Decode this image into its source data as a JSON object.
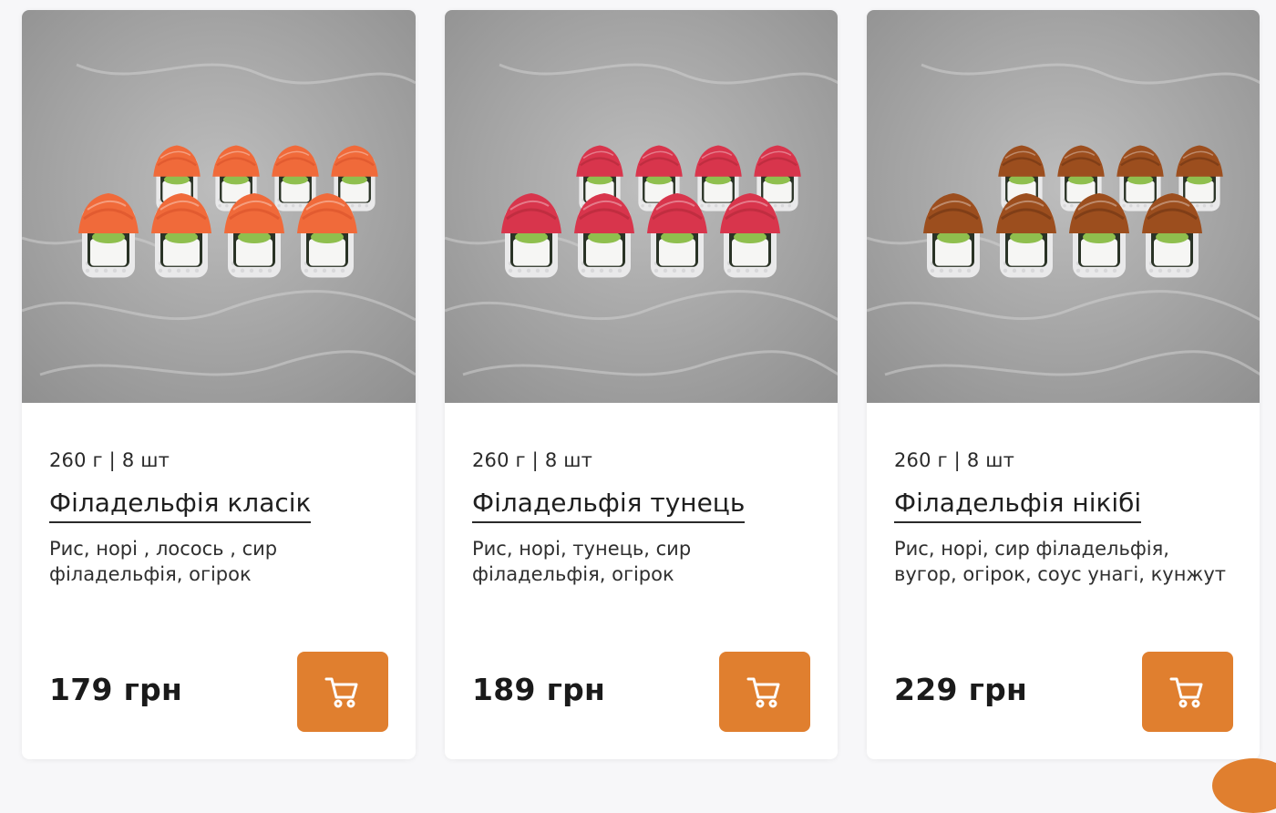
{
  "theme": {
    "accent": "#E07F2F",
    "background": "#f7f7f9"
  },
  "products": [
    {
      "weight": "260 г | 8 шт",
      "title": "Філадельфія класік",
      "description": "Рис, норі , лосось , сир філадельфія, огірок",
      "price": "179 грн",
      "topping_color": "#F06A3A",
      "topping_shade": "#d8522a",
      "image_icon": "sushi-salmon-image"
    },
    {
      "weight": "260 г | 8 шт",
      "title": "Філадельфія тунець",
      "description": "Рис, норі, тунець, сир філадельфія, огірок",
      "price": "189 грн",
      "topping_color": "#D8354C",
      "topping_shade": "#b12838",
      "image_icon": "sushi-tuna-image"
    },
    {
      "weight": "260 г | 8 шт",
      "title": "Філадельфія нікібі",
      "description": "Рис, норі, сир філадельфія, вугор, огірок, соус унагі, кунжут",
      "price": "229 грн",
      "topping_color": "#9C4E1E",
      "topping_shade": "#6e3312",
      "image_icon": "sushi-eel-image"
    }
  ],
  "cart_icon": "cart-icon"
}
